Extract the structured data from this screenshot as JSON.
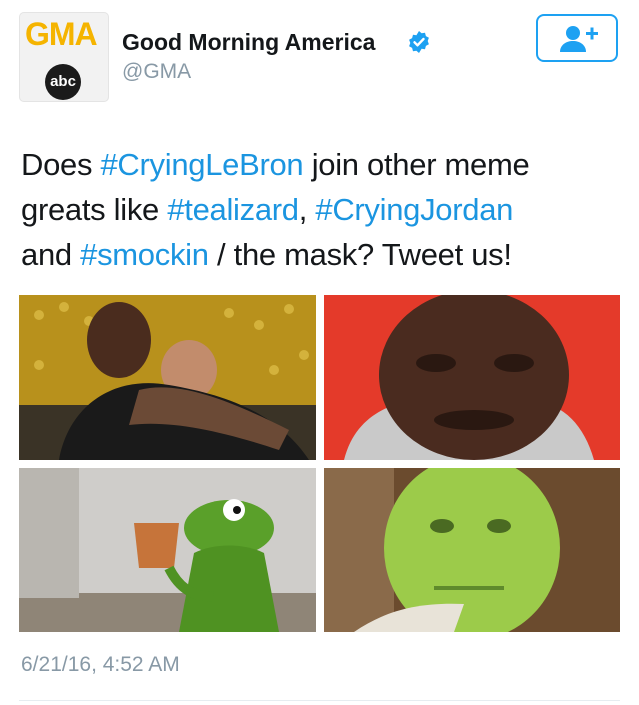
{
  "account": {
    "name": "Good Morning America",
    "handle": "@GMA",
    "avatar_logo_text": "GMA",
    "avatar_network_text": "abc",
    "verified": true
  },
  "follow_button": {
    "icon": "add-user-icon"
  },
  "tweet": {
    "lines": [
      [
        {
          "text": "Does ",
          "tag": false
        },
        {
          "text": "#CryingLeBron",
          "tag": true
        },
        {
          "text": " join other meme",
          "tag": false
        }
      ],
      [
        {
          "text": "greats like ",
          "tag": false
        },
        {
          "text": "#tealizard",
          "tag": true
        },
        {
          "text": ", ",
          "tag": false
        },
        {
          "text": "#CryingJordan",
          "tag": true
        }
      ],
      [
        {
          "text": "and ",
          "tag": false
        },
        {
          "text": "#smockin",
          "tag": true
        },
        {
          "text": " / the mask? Tweet us!",
          "tag": false
        }
      ]
    ]
  },
  "media": {
    "photos": [
      {
        "subject": "crying-lebron-photo"
      },
      {
        "subject": "crying-jordan-photo"
      },
      {
        "subject": "kermit-tea-photo"
      },
      {
        "subject": "the-mask-photo"
      }
    ]
  },
  "timestamp": "6/21/16, 4:52 AM",
  "colors": {
    "link": "#1b95e0",
    "accent": "#1da1f2",
    "muted": "#8899a6",
    "gma_yellow": "#f5b400"
  }
}
